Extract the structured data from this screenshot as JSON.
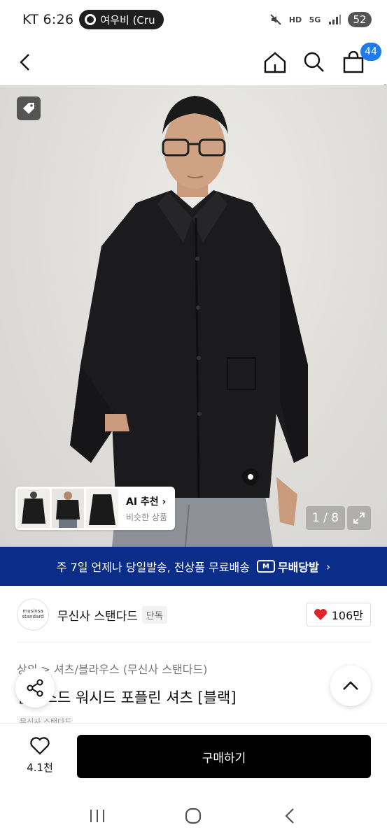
{
  "status_bar": {
    "carrier_time": "KT 6:26",
    "pill_text": "여우비 (Cru",
    "hd_label": "HD",
    "net_label": "5G",
    "battery": "52"
  },
  "header": {
    "cart_count": "44"
  },
  "hero": {
    "ai_title": "AI 추천",
    "ai_subtitle": "비슷한 상품",
    "image_counter": "1 / 8"
  },
  "promo_banner": {
    "text": "주 7일 언제나 당일발송, 전상품 무료배송",
    "brand_label": "무배당발",
    "brand_mark": "M"
  },
  "store": {
    "logo_line1": "musinsa",
    "logo_line2": "standard",
    "name": "무신사 스탠다드",
    "chip": "단독",
    "likes": "106만"
  },
  "product": {
    "breadcrumb": "상의 > 셔츠/블라우스 (무신사 스탠다드)",
    "title": "릴랙스드 워시드 포플린 셔츠 [블랙]",
    "brand_partial": "무신사 스탠다드"
  },
  "bottom_bar": {
    "wish_count": "4.1천",
    "buy_label": "구매하기"
  },
  "colors": {
    "accent": "#1f7aec",
    "promo_bg": "#0a2d8a",
    "heart": "#e0242e",
    "buy_bg": "#000000"
  }
}
